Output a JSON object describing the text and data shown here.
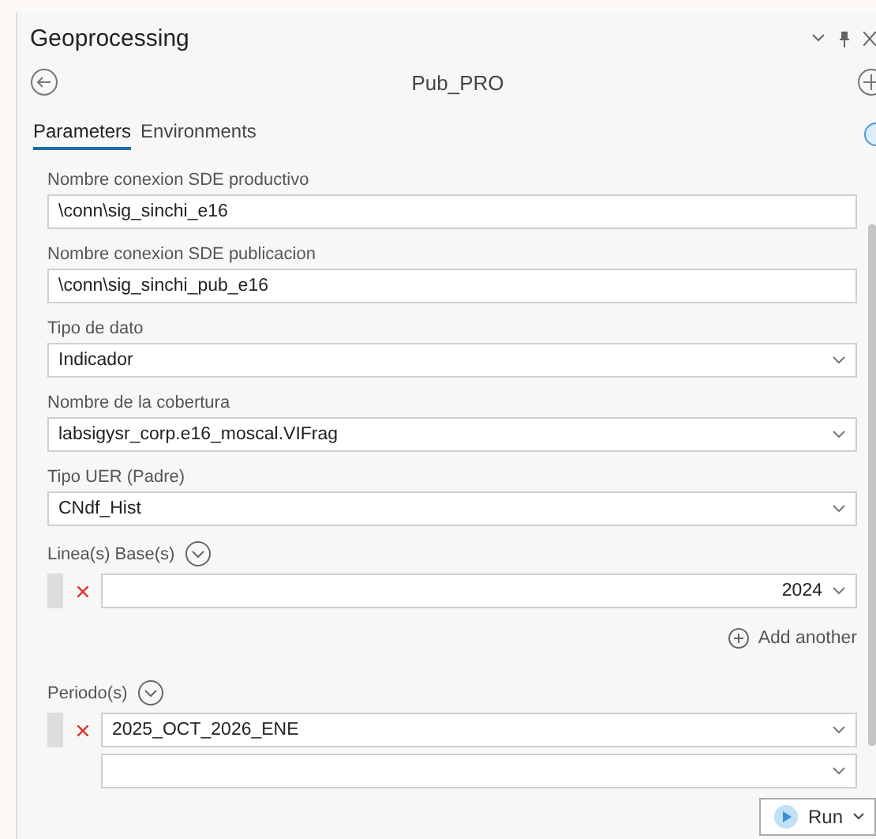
{
  "pane": {
    "title": "Geoprocessing",
    "tool_name": "Pub_PRO"
  },
  "tabs": [
    {
      "label": "Parameters",
      "selected": true
    },
    {
      "label": "Environments",
      "selected": false
    }
  ],
  "parameters": [
    {
      "kind": "text",
      "label": "Nombre conexion SDE productivo",
      "value": "\\conn\\sig_sinchi_e16"
    },
    {
      "kind": "text",
      "label": "Nombre conexion SDE publicacion",
      "value": "\\conn\\sig_sinchi_pub_e16"
    },
    {
      "kind": "select",
      "label": "Tipo de dato",
      "value": "Indicador"
    },
    {
      "kind": "select",
      "label": "Nombre de la cobertura",
      "value": "labsigysr_corp.e16_moscal.VIFrag"
    },
    {
      "kind": "select",
      "label": "Tipo UER (Padre)",
      "value": "CNdf_Hist"
    },
    {
      "kind": "multi",
      "label": "Linea(s) Base(s)",
      "expanded": false,
      "rows": [
        {
          "kind": "number",
          "removable": true,
          "value": "2024"
        }
      ],
      "add_label": "Add another"
    },
    {
      "kind": "multi",
      "label": "Periodo(s)",
      "expanded": false,
      "rows": [
        {
          "kind": "text",
          "removable": true,
          "value": "2025_OCT_2026_ENE"
        },
        {
          "kind": "text",
          "removable": false
        }
      ]
    }
  ],
  "run_button": {
    "label": "Run"
  }
}
